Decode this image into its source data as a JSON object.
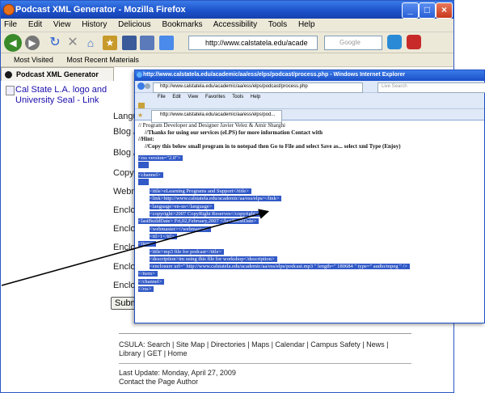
{
  "firefox": {
    "title": "Podcast XML Generator - Mozilla Firefox",
    "menu": [
      "File",
      "Edit",
      "View",
      "History",
      "Delicious",
      "Bookmarks",
      "Accessibility",
      "Tools",
      "Help"
    ],
    "url": "http://www.calstatela.edu/acade",
    "search_placeholder": "Google",
    "bookmarks": [
      "Most Visited",
      "Most Recent Materials"
    ],
    "tab_title": "Podcast XML Generator",
    "logo_alt": "Cal State L.A. logo and University Seal - Link",
    "form_labels": [
      "Langu",
      "Blog / V",
      "Blog / V",
      "Copyri",
      "Webma",
      "Enclos",
      "Enclos",
      "Enclos",
      "Enclos",
      "Enclos"
    ],
    "submit_label": "Subm",
    "footer_links": "CSULA: Search | Site Map | Directories | Maps | Calendar | Campus Safety | News | Library | GET | Home",
    "last_update": "Last Update: Monday, April 27, 2009",
    "contact": "Contact the Page Author"
  },
  "ie": {
    "title": "http://www.calstatela.edu/academic/aa/ess/elps/podcast/process.php - Windows Internet Explorer",
    "url": "http://www.calstatela.edu/academic/aa/ess/elps/podcast/process.php",
    "search_placeholder": "Live Search",
    "menu": [
      "File",
      "Edit",
      "View",
      "Favorites",
      "Tools",
      "Help"
    ],
    "tab_title": "http://www.calstatela.edu/academic/aa/ess/elps/pod...",
    "credits": "// Program Developer and Designer Javier Velez & Amir Sharghi",
    "thanks": "//Thanks for using our services (eLPS) for more information Contact with",
    "hint": "//Hint:",
    "instructions": "//Copy this below small program in to notepad then Go to File and select Save as... select xml Type (Enjoy)",
    "xml_lines": [
      "<rss version=\"2.0\">",
      "",
      "<channel>",
      "",
      "<title>eLearning Programs and Support</title>",
      "<link>http://www.calstatela.edu/academic/aa/ess/elps/</link>",
      "<language>en-us</language>",
      "<copyright>2007 CopyRight Reserves</copyright>",
      "<lastBuildDate> Fri,02,February,2007 </lastBuildDate>",
      "<webmaster></webmaster>",
      "<ttl>1</ttl>",
      "<item>",
      "<title>mp3 file for podcast</title>",
      "<description>im using this file for workshop</description>",
      "<enclosure url=\" http://www.calstatela.edu/academic/aa/ess/elps/podcast.mp3 \" length=\" 180684 \" type=\" audio/mpeg \" />",
      "</item>",
      "</channel>",
      "</rss>"
    ]
  }
}
